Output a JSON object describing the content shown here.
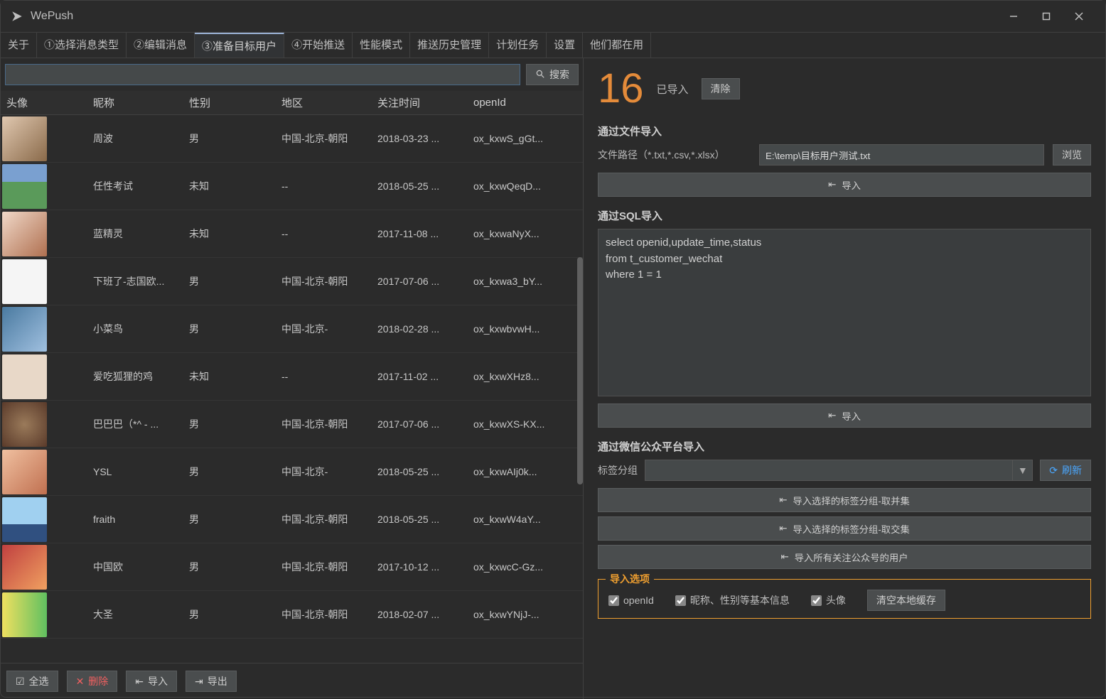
{
  "app": {
    "title": "WePush"
  },
  "tabs": {
    "items": [
      "关于",
      "①选择消息类型",
      "②编辑消息",
      "③准备目标用户",
      "④开始推送",
      "性能模式",
      "推送历史管理",
      "计划任务",
      "设置",
      "他们都在用"
    ],
    "active_index": 3
  },
  "search": {
    "placeholder": "",
    "button": "搜索"
  },
  "table": {
    "headers": {
      "avatar": "头像",
      "nickname": "昵称",
      "gender": "性别",
      "region": "地区",
      "follow_time": "关注时间",
      "openid": "openId"
    },
    "rows": [
      {
        "nickname": "周波",
        "gender": "男",
        "region": "中国-北京-朝阳",
        "follow_time": "2018-03-23 ...",
        "openid": "ox_kxwS_gGt...",
        "av": "linear-gradient(135deg,#e0c8b0,#8a6a4a)"
      },
      {
        "nickname": "任性考试",
        "gender": "未知",
        "region": "--",
        "follow_time": "2018-05-25 ...",
        "openid": "ox_kxwQeqD...",
        "av": "linear-gradient(180deg,#7aa0d0 40%,#5a9a5a 40%)"
      },
      {
        "nickname": "蓝精灵",
        "gender": "未知",
        "region": "--",
        "follow_time": "2017-11-08 ...",
        "openid": "ox_kxwaNyX...",
        "av": "linear-gradient(135deg,#f0d8c8,#b07050)"
      },
      {
        "nickname": "下班了-志国欧...",
        "gender": "男",
        "region": "中国-北京-朝阳",
        "follow_time": "2017-07-06 ...",
        "openid": "ox_kxwa3_bY...",
        "av": "#f5f5f5"
      },
      {
        "nickname": "小菜鸟",
        "gender": "男",
        "region": "中国-北京-",
        "follow_time": "2018-02-28 ...",
        "openid": "ox_kxwbvwH...",
        "av": "linear-gradient(135deg,#4a7aa0,#a0c0e0)"
      },
      {
        "nickname": "爱吃狐狸的鸡",
        "gender": "未知",
        "region": "--",
        "follow_time": "2017-11-02 ...",
        "openid": "ox_kxwXHz8...",
        "av": "#e8d8c8"
      },
      {
        "nickname": "巴巴巴（*^ - ...",
        "gender": "男",
        "region": "中国-北京-朝阳",
        "follow_time": "2017-07-06 ...",
        "openid": "ox_kxwXS-KX...",
        "av": "radial-gradient(circle,#9a7a5a,#5a3a2a)"
      },
      {
        "nickname": "YSL",
        "gender": "男",
        "region": "中国-北京-",
        "follow_time": "2018-05-25 ...",
        "openid": "ox_kxwAIj0k...",
        "av": "linear-gradient(135deg,#f0c0a0,#c07050)"
      },
      {
        "nickname": "fraith",
        "gender": "男",
        "region": "中国-北京-朝阳",
        "follow_time": "2018-05-25 ...",
        "openid": "ox_kxwW4aY...",
        "av": "linear-gradient(180deg,#a0d0f0 60%,#305080 60%)"
      },
      {
        "nickname": "中国欧",
        "gender": "男",
        "region": "中国-北京-朝阳",
        "follow_time": "2017-10-12 ...",
        "openid": "ox_kxwcC-Gz...",
        "av": "linear-gradient(135deg,#c04040,#f0a060)"
      },
      {
        "nickname": "大圣",
        "gender": "男",
        "region": "中国-北京-朝阳",
        "follow_time": "2018-02-07 ...",
        "openid": "ox_kxwYNjJ-...",
        "av": "linear-gradient(90deg,#f0e060,#60c060)"
      }
    ]
  },
  "left_actions": {
    "select_all": "全选",
    "delete": "删除",
    "import": "导入",
    "export": "导出"
  },
  "right": {
    "count": "16",
    "imported": "已导入",
    "clear": "清除",
    "file_section": {
      "title": "通过文件导入",
      "label": "文件路径（*.txt,*.csv,*.xlsx）",
      "path": "E:\\temp\\目标用户测试.txt",
      "browse": "浏览",
      "import": "导入"
    },
    "sql_section": {
      "title": "通过SQL导入",
      "sql": "select openid,update_time,status\nfrom t_customer_wechat\nwhere 1 = 1",
      "import": "导入"
    },
    "wx_section": {
      "title": "通过微信公众平台导入",
      "tag_label": "标签分组",
      "refresh": "刷新",
      "import_union": "导入选择的标签分组-取并集",
      "import_intersect": "导入选择的标签分组-取交集",
      "import_all": "导入所有关注公众号的用户"
    },
    "options": {
      "legend": "导入选项",
      "openid": "openId",
      "basic": "昵称、性别等基本信息",
      "avatar": "头像",
      "clear_cache": "清空本地缓存"
    }
  }
}
